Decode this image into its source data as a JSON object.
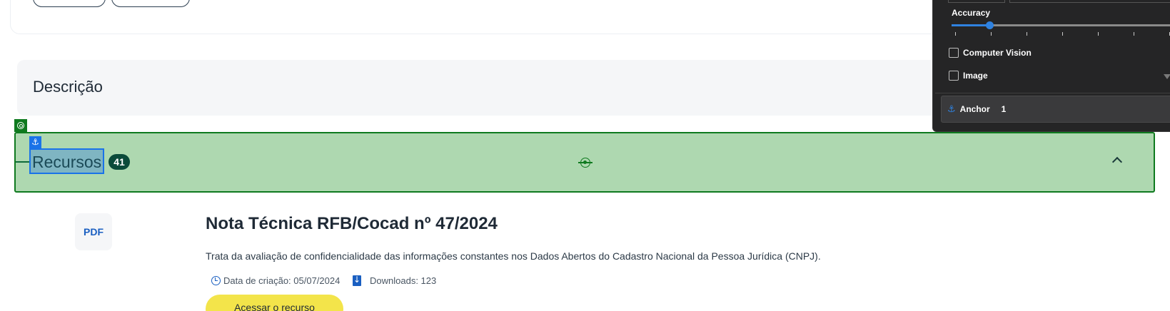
{
  "description_section": {
    "title": "Descrição"
  },
  "resources_section": {
    "title": "Recursos",
    "count": "41"
  },
  "resource": {
    "type": "PDF",
    "title": "Nota Técnica RFB/Cocad nº 47/2024",
    "description": "Trata da avaliação de confidencialidade das informações constantes nos Dados Abertos do Cadastro Nacional da Pessoa Jurídica (CNPJ).",
    "created": "Data de criação: 05/07/2024",
    "downloads": "Downloads: 123",
    "access_label": "Acessar o recurso"
  },
  "overlay_panel": {
    "accuracy_label": "Accuracy",
    "accuracy_value": 0.17,
    "checkboxes": [
      {
        "label": "Computer Vision",
        "checked": false
      },
      {
        "label": "Image",
        "checked": false
      }
    ],
    "anchor_label": "Anchor",
    "anchor_count": "1"
  },
  "icons": {
    "anchor": "⚓",
    "target": "target-icon",
    "chevron": "chevron-up-icon",
    "clock": "clock-icon",
    "download": "download-icon"
  },
  "colors": {
    "highlight_fill": "#aed8b0",
    "highlight_border": "#0f7a1f",
    "anchor_blue": "#1a73e8",
    "badge": "#0b4a3a",
    "button_yellow": "#f3e44a",
    "panel_bg": "#252526"
  }
}
